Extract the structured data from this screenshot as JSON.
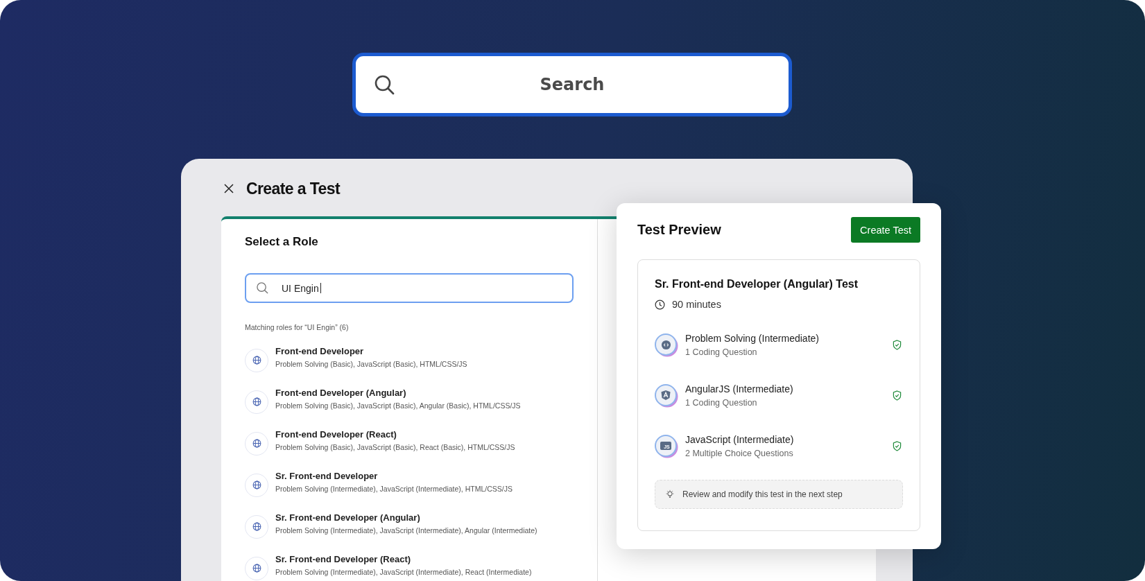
{
  "search": {
    "placeholder": "Search"
  },
  "modal": {
    "title": "Create a Test",
    "role_panel": {
      "heading": "Select a Role",
      "search_value": "UI Engin",
      "results_label": "Matching roles for “UI Engin” (6)",
      "roles": [
        {
          "name": "Front-end Developer",
          "skills": "Problem Solving (Basic), JavaScript (Basic), HTML/CSS/JS"
        },
        {
          "name": "Front-end Developer (Angular)",
          "skills": "Problem Solving (Basic), JavaScript (Basic), Angular (Basic), HTML/CSS/JS"
        },
        {
          "name": "Front-end Developer (React)",
          "skills": "Problem Solving (Basic), JavaScript (Basic), React (Basic), HTML/CSS/JS"
        },
        {
          "name": "Sr. Front-end Developer",
          "skills": "Problem Solving (Intermediate), JavaScript (Intermediate), HTML/CSS/JS"
        },
        {
          "name": "Sr. Front-end Developer (Angular)",
          "skills": "Problem Solving (Intermediate), JavaScript (Intermediate), Angular (Intermediate)"
        },
        {
          "name": "Sr. Front-end Developer (React)",
          "skills": "Problem Solving (Intermediate), JavaScript (Intermediate), React (Intermediate)"
        }
      ]
    }
  },
  "preview": {
    "title": "Test Preview",
    "button": "Create Test",
    "test_name": "Sr. Front-end Developer (Angular) Test",
    "duration": "90 minutes",
    "sections": [
      {
        "kind": "code",
        "name": "Problem Solving (Intermediate)",
        "detail": "1 Coding Question",
        "verified": true
      },
      {
        "kind": "angular",
        "name": "AngularJS (Intermediate)",
        "detail": "1 Coding Question",
        "verified": true
      },
      {
        "kind": "js",
        "badge": "JS",
        "name": "JavaScript (Intermediate)",
        "detail": "2 Multiple Choice Questions",
        "verified": true
      }
    ],
    "tip": "Review and modify this test in the next step"
  }
}
